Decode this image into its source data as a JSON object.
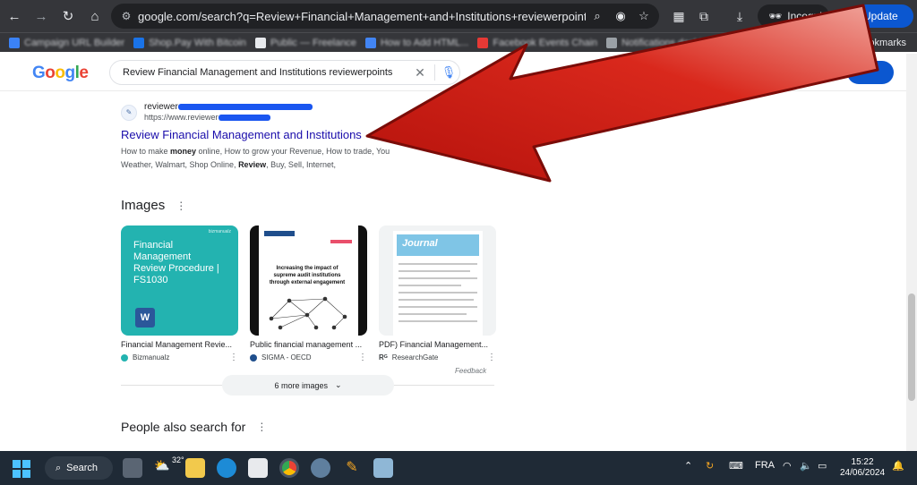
{
  "browser": {
    "url": "google.com/search?q=Review+Financial+Management+and+Institutions+reviewerpoints&oq=Revi...",
    "incognito_label": "Incognito",
    "update_label": "Update",
    "bookmarks": [
      {
        "label": "Campaign URL Builder",
        "color": "#3b82f6"
      },
      {
        "label": "Shop.Pay With Bitcoin",
        "color": "#1a73e8"
      },
      {
        "label": "Public — Freelance",
        "color": "#e8eaed"
      },
      {
        "label": "How to Add HTML...",
        "color": "#4285f4"
      },
      {
        "label": "Facebook Events Chain",
        "color": "#e53935"
      },
      {
        "label": "Notifications dashboard",
        "color": "#9aa0a6"
      }
    ],
    "bookmarks_more": "Bookmarks"
  },
  "google": {
    "logo": [
      "G",
      "o",
      "o",
      "g",
      "l",
      "e"
    ],
    "logo_colors": [
      "#4285f4",
      "#ea4335",
      "#fbbc05",
      "#4285f4",
      "#34a853",
      "#ea4335"
    ],
    "query": "Review Financial Management and Institutions reviewerpoints"
  },
  "result": {
    "site_name": "reviewer",
    "site_url": "https://www.reviewer",
    "title": "Review Financial Management and Institutions",
    "snippet_1": "How to make ",
    "snippet_bold_1": "money",
    "snippet_2": " online, How to grow your Revenue, How to trade, You",
    "snippet_3": "Weather, Walmart, Shop Online, ",
    "snippet_bold_2": "Review",
    "snippet_4": ", Buy, Sell, Internet,"
  },
  "images": {
    "heading": "Images",
    "items": [
      {
        "caption": "Financial Management Revie...",
        "source": "Bizmanualz",
        "source_color": "#23b3b0",
        "thumb_title": "Financial Management Review Procedure | FS1030",
        "thumb_tag": "bizmanualz"
      },
      {
        "caption": "Public financial management ...",
        "source": "SIGMA - OECD",
        "source_color": "#1f4e8c",
        "thumb_title": "Increasing the impact of supreme audit institutions through external engagement"
      },
      {
        "caption": "PDF) Financial Management...",
        "source": "ResearchGate",
        "source_color": "#40ba9b",
        "thumb_title": "Journal"
      }
    ],
    "feedback": "Feedback",
    "more_label": "6 more images"
  },
  "people_also_search": "People also search for",
  "taskbar": {
    "search_label": "Search",
    "temperature": "32°",
    "language": "FRA",
    "time": "15:22",
    "date": "24/06/2024"
  },
  "annotation": {
    "arrow_color": "#c8130e"
  }
}
